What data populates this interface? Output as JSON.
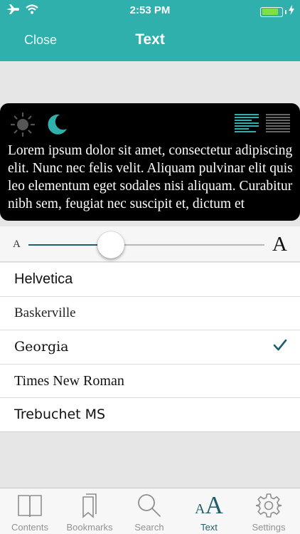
{
  "status_bar": {
    "time": "2:53 PM",
    "battery_level": 0.85
  },
  "nav": {
    "close_label": "Close",
    "title": "Text"
  },
  "preview": {
    "text": "Lorem ipsum dolor sit amet, consectetur adipiscing elit. Nunc nec felis velit. Aliquam pulvinar elit quis leo elementum eget sodales nisi aliquam. Curabitur nibh sem, feugiat nec suscipit et, dictum et",
    "theme_icons": [
      "sun-icon",
      "moon-icon"
    ],
    "alignment_icons": [
      "align-left-icon",
      "align-justify-icon"
    ],
    "accent_color": "#2fb0ad"
  },
  "size_slider": {
    "small_label": "A",
    "large_label": "A",
    "value": 0.35
  },
  "fonts": {
    "items": [
      {
        "label": "Helvetica",
        "selected": false
      },
      {
        "label": "Baskerville",
        "selected": false
      },
      {
        "label": "Georgia",
        "selected": true
      },
      {
        "label": "Times New Roman",
        "selected": false
      },
      {
        "label": "Trebuchet MS",
        "selected": false
      }
    ]
  },
  "tab_bar": {
    "items": [
      {
        "label": "Contents",
        "icon": "book-icon"
      },
      {
        "label": "Bookmarks",
        "icon": "bookmark-icon"
      },
      {
        "label": "Search",
        "icon": "search-icon"
      },
      {
        "label": "Text",
        "icon": "text-size-icon",
        "icon_small": "A",
        "icon_large": "A"
      },
      {
        "label": "Settings",
        "icon": "gear-icon"
      }
    ],
    "active_index": 3
  },
  "colors": {
    "brand": "#2fb0ad",
    "active": "#1f5e6b",
    "battery": "#7ee043"
  }
}
